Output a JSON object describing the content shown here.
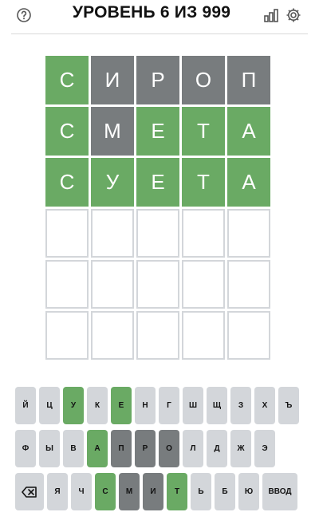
{
  "header": {
    "title": "УРОВЕНЬ 6 ИЗ 999",
    "icons": [
      "help-icon",
      "stats-icon",
      "settings-icon"
    ]
  },
  "board": {
    "rows": [
      [
        {
          "letter": "С",
          "state": "correct"
        },
        {
          "letter": "И",
          "state": "absent"
        },
        {
          "letter": "Р",
          "state": "absent"
        },
        {
          "letter": "О",
          "state": "absent"
        },
        {
          "letter": "П",
          "state": "absent"
        }
      ],
      [
        {
          "letter": "С",
          "state": "correct"
        },
        {
          "letter": "М",
          "state": "absent"
        },
        {
          "letter": "Е",
          "state": "correct"
        },
        {
          "letter": "Т",
          "state": "correct"
        },
        {
          "letter": "А",
          "state": "correct"
        }
      ],
      [
        {
          "letter": "С",
          "state": "correct"
        },
        {
          "letter": "У",
          "state": "correct"
        },
        {
          "letter": "Е",
          "state": "correct"
        },
        {
          "letter": "Т",
          "state": "correct"
        },
        {
          "letter": "А",
          "state": "correct"
        }
      ],
      [
        {
          "letter": "",
          "state": "empty"
        },
        {
          "letter": "",
          "state": "empty"
        },
        {
          "letter": "",
          "state": "empty"
        },
        {
          "letter": "",
          "state": "empty"
        },
        {
          "letter": "",
          "state": "empty"
        }
      ],
      [
        {
          "letter": "",
          "state": "empty"
        },
        {
          "letter": "",
          "state": "empty"
        },
        {
          "letter": "",
          "state": "empty"
        },
        {
          "letter": "",
          "state": "empty"
        },
        {
          "letter": "",
          "state": "empty"
        }
      ],
      [
        {
          "letter": "",
          "state": "empty"
        },
        {
          "letter": "",
          "state": "empty"
        },
        {
          "letter": "",
          "state": "empty"
        },
        {
          "letter": "",
          "state": "empty"
        },
        {
          "letter": "",
          "state": "empty"
        }
      ]
    ]
  },
  "keyboard": {
    "rows": [
      [
        {
          "label": "Й",
          "state": "default"
        },
        {
          "label": "Ц",
          "state": "default"
        },
        {
          "label": "У",
          "state": "correct"
        },
        {
          "label": "К",
          "state": "default"
        },
        {
          "label": "Е",
          "state": "correct"
        },
        {
          "label": "Н",
          "state": "default"
        },
        {
          "label": "Г",
          "state": "default"
        },
        {
          "label": "Ш",
          "state": "default"
        },
        {
          "label": "Щ",
          "state": "default"
        },
        {
          "label": "З",
          "state": "default"
        },
        {
          "label": "Х",
          "state": "default"
        },
        {
          "label": "Ъ",
          "state": "default"
        }
      ],
      [
        {
          "label": "Ф",
          "state": "default"
        },
        {
          "label": "Ы",
          "state": "default"
        },
        {
          "label": "В",
          "state": "default"
        },
        {
          "label": "А",
          "state": "correct"
        },
        {
          "label": "П",
          "state": "absent"
        },
        {
          "label": "Р",
          "state": "absent"
        },
        {
          "label": "О",
          "state": "absent"
        },
        {
          "label": "Л",
          "state": "default"
        },
        {
          "label": "Д",
          "state": "default"
        },
        {
          "label": "Ж",
          "state": "default"
        },
        {
          "label": "Э",
          "state": "default"
        }
      ],
      [
        {
          "label": "⌫",
          "state": "default",
          "kind": "back"
        },
        {
          "label": "Я",
          "state": "default"
        },
        {
          "label": "Ч",
          "state": "default"
        },
        {
          "label": "С",
          "state": "correct"
        },
        {
          "label": "М",
          "state": "absent"
        },
        {
          "label": "И",
          "state": "absent"
        },
        {
          "label": "Т",
          "state": "correct"
        },
        {
          "label": "Ь",
          "state": "default"
        },
        {
          "label": "Б",
          "state": "default"
        },
        {
          "label": "Ю",
          "state": "default"
        },
        {
          "label": "ВВОД",
          "state": "default",
          "kind": "enter"
        }
      ]
    ]
  },
  "colors": {
    "correct": "#6aaa64",
    "absent": "#787c7e",
    "key_default": "#d3d6da",
    "tile_border": "#d3d6da"
  }
}
